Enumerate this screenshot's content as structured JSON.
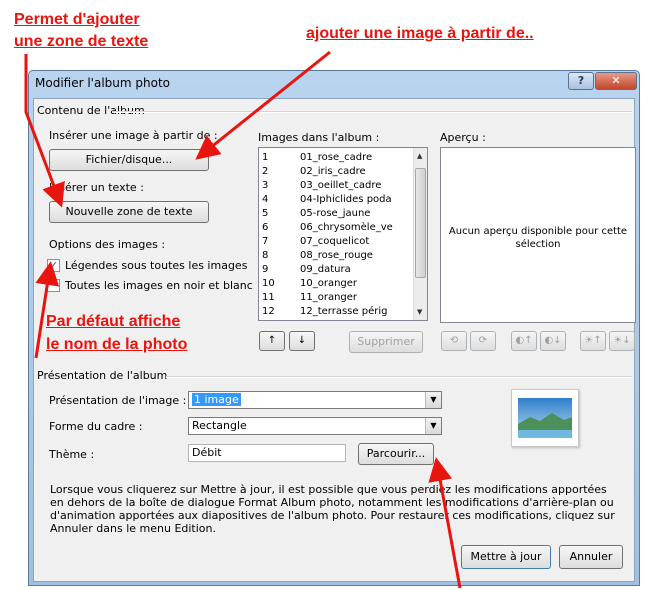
{
  "annotations": {
    "text_zone": [
      "Permet d'ajouter",
      "une zone de texte"
    ],
    "add_image": "ajouter une image à partir de..",
    "caption_default": [
      "Par défaut affiche",
      "le nom de la photo"
    ],
    "color": "#e8150f"
  },
  "dialog": {
    "title": "Modifier l'album photo",
    "help_label": "?",
    "close_label": "✕",
    "content_group": "Contenu de l'album",
    "insert_image_label": "Insérer une image à partir de :",
    "file_disk_button": "Fichier/disque...",
    "insert_text_label": "Insérer un texte :",
    "new_textbox_button": "Nouvelle zone de texte",
    "image_options_label": "Options des images :",
    "captions_checkbox": {
      "label": "Légendes sous toutes les images",
      "checked": true
    },
    "bw_checkbox": {
      "label": "Toutes les images en noir et blanc",
      "checked": false
    },
    "images_in_album_label": "Images dans l'album :",
    "images": [
      {
        "n": "1",
        "name": "01_rose_cadre"
      },
      {
        "n": "2",
        "name": "02_iris_cadre"
      },
      {
        "n": "3",
        "name": "03_oeillet_cadre"
      },
      {
        "n": "4",
        "name": "04-Iphiclides poda"
      },
      {
        "n": "5",
        "name": "05-rose_jaune"
      },
      {
        "n": "6",
        "name": "06_chrysomèle_ve"
      },
      {
        "n": "7",
        "name": "07_coquelicot"
      },
      {
        "n": "8",
        "name": "08_rose_rouge"
      },
      {
        "n": "9",
        "name": "09_datura"
      },
      {
        "n": "10",
        "name": "10_oranger"
      },
      {
        "n": "11",
        "name": "11_oranger"
      },
      {
        "n": "12",
        "name": "12_terrasse périg"
      }
    ],
    "preview_label": "Aperçu :",
    "preview_text": "Aucun aperçu disponible pour cette sélection",
    "move_up": "↑",
    "move_down": "↓",
    "remove_button": "Supprimer",
    "rotate_buttons": [
      "⟲",
      "⟳"
    ],
    "contrast_buttons": [
      "◐↑",
      "◐↓"
    ],
    "brightness_buttons": [
      "☀↑",
      "☀↓"
    ],
    "layout_group": "Présentation de l'album",
    "picture_layout_label": "Présentation de l'image :",
    "picture_layout_value": "1 image",
    "frame_shape_label": "Forme du cadre :",
    "frame_shape_value": "Rectangle",
    "theme_label": "Thème :",
    "theme_value": "Débit",
    "browse_button": "Parcourir...",
    "info_text": "Lorsque vous cliquerez sur Mettre à jour, il est possible que vous perdiez les modifications apportées en dehors de la boîte de dialogue Format Album photo, notamment les modifications d'arrière-plan ou d'animation apportées aux diapositives de l'album photo. Pour restaurer ces modifications, cliquez sur Annuler dans le menu Edition.",
    "update_button": "Mettre à jour",
    "cancel_button": "Annuler"
  }
}
